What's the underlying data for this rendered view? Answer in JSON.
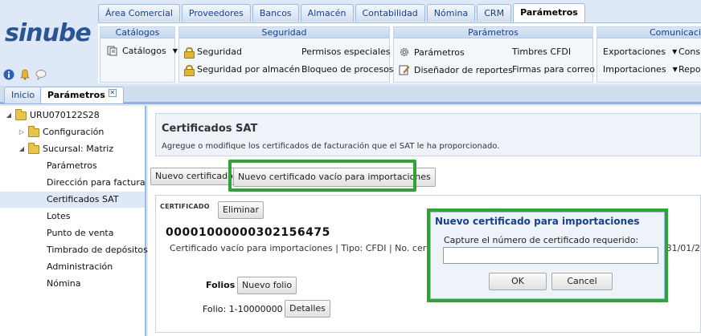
{
  "app": {
    "logo": "sinube"
  },
  "main_tabs": [
    {
      "label": "Área Comercial"
    },
    {
      "label": "Proveedores"
    },
    {
      "label": "Bancos"
    },
    {
      "label": "Almacén"
    },
    {
      "label": "Contabilidad"
    },
    {
      "label": "Nómina"
    },
    {
      "label": "CRM"
    },
    {
      "label": "Parámetros",
      "active": true
    }
  ],
  "ribbon": {
    "catalogos": {
      "title": "Catálogos",
      "items": [
        "Catálogos"
      ]
    },
    "seguridad": {
      "title": "Seguridad",
      "items": [
        "Seguridad",
        "Seguridad por almacén",
        "Permisos especiales",
        "Bloqueo de procesos"
      ]
    },
    "parametros": {
      "title": "Parámetros",
      "items": [
        "Parámetros",
        "Diseñador de reportes",
        "Timbres CFDI",
        "Firmas para correo"
      ]
    },
    "comunicacion": {
      "title": "Comunicacion",
      "items": [
        "Exportaciones",
        "Importaciones",
        "Consu",
        "Repor"
      ]
    }
  },
  "doc_tabs": [
    {
      "label": "Inicio"
    },
    {
      "label": "Parámetros",
      "active": true
    }
  ],
  "tree": {
    "root": "URU070122S28",
    "configuracion": "Configuración",
    "sucursal": "Sucursal: Matriz",
    "children": [
      "Parámetros",
      "Dirección para facturación",
      "Certificados SAT",
      "Lotes",
      "Punto de venta",
      "Timbrado de depósitos",
      "Administración",
      "Nómina"
    ],
    "selected": "Certificados SAT"
  },
  "panel": {
    "title": "Certificados SAT",
    "subtitle": "Agregue o modifique los certificados de facturación que el SAT le ha proporcionado.",
    "btn_new": "Nuevo certificado",
    "btn_new_empty": "Nuevo certificado vacío para importaciones"
  },
  "certificate": {
    "section_label": "CERTIFICADO",
    "btn_delete": "Eliminar",
    "number": "00001000000302156475",
    "description": "Certificado vacío para importaciones | Tipo: CFDI | No. certificado",
    "date_fragment": "31/01/2",
    "folios_label": "Folios",
    "btn_new_folio": "Nuevo folio",
    "folio_range": "Folio: 1-10000000",
    "btn_details": "Detalles"
  },
  "dialog": {
    "title": "Nuevo certificado para importaciones",
    "prompt": "Capture el número de certificado requerido:",
    "input_value": "",
    "btn_ok": "OK",
    "btn_cancel": "Cancel"
  },
  "colors": {
    "highlight": "#2fa334",
    "brand": "#2a5595",
    "accent": "#15428b"
  }
}
